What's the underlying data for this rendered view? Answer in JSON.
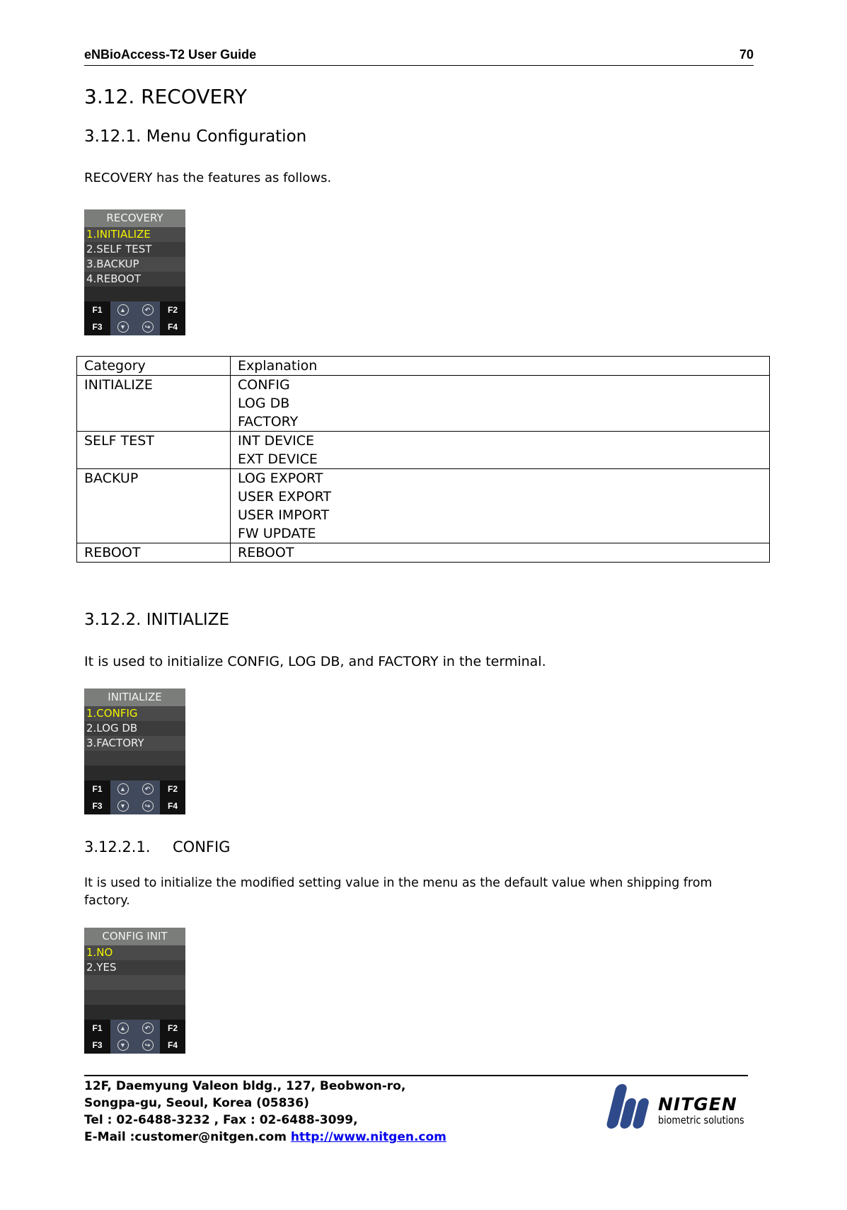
{
  "header": {
    "title": "eNBioAccess-T2 User Guide",
    "page": "70"
  },
  "section": {
    "title": "3.12.  RECOVERY"
  },
  "s1": {
    "title": "3.12.1. Menu Configuration",
    "intro": "RECOVERY has the features as follows."
  },
  "lcd1": {
    "title": "RECOVERY",
    "rows": [
      "1.INITIALIZE",
      "2.SELF TEST",
      "3.BACKUP",
      "4.REBOOT"
    ]
  },
  "keys": {
    "f1": "F1",
    "f2": "F2",
    "f3": "F3",
    "f4": "F4",
    "up": "up-arrow-icon",
    "back": "back-arrow-icon",
    "down": "down-arrow-icon",
    "enter": "enter-arrow-icon"
  },
  "table": {
    "headers": [
      "Category",
      "Explanation"
    ],
    "rows": [
      {
        "category": "INITIALIZE",
        "items": [
          "CONFIG",
          "LOG DB",
          "FACTORY"
        ]
      },
      {
        "category": "SELF TEST",
        "items": [
          "INT DEVICE",
          "EXT DEVICE"
        ]
      },
      {
        "category": "BACKUP",
        "items": [
          "LOG EXPORT",
          "USER EXPORT",
          "USER IMPORT",
          "FW UPDATE"
        ]
      },
      {
        "category": "REBOOT",
        "items": [
          "REBOOT"
        ]
      }
    ]
  },
  "s2": {
    "title": "3.12.2. INITIALIZE",
    "text": "It is used to initialize CONFIG, LOG DB, and FACTORY in the terminal."
  },
  "lcd2": {
    "title": "INITIALIZE",
    "rows": [
      "1.CONFIG",
      "2.LOG DB",
      "3.FACTORY"
    ]
  },
  "s3": {
    "title": "3.12.2.1.",
    "title2": "CONFIG",
    "text1": "It is used to initialize the modified setting value in the menu as the default value when shipping from",
    "text2": "factory."
  },
  "lcd3": {
    "title": "CONFIG INIT",
    "rows": [
      "1.NO",
      "2.YES"
    ]
  },
  "footer": {
    "line1": "12F, Daemyung Valeon bldg., 127, Beobwon-ro,",
    "line2": "Songpa-gu, Seoul, Korea (05836)",
    "line3": "Tel : 02-6488-3232 , Fax : 02-6488-3099,",
    "line4": "E-Mail :customer@nitgen.com",
    "link": "http://www.nitgen.com",
    "logo_name": "NITGEN",
    "logo_tag": "biometric solutions",
    "logo_color": "#2e4a8a"
  }
}
